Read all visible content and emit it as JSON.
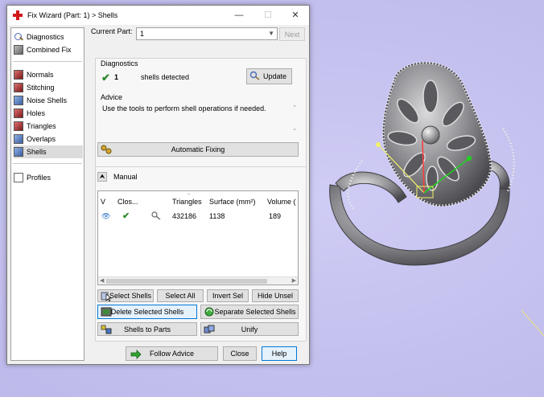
{
  "window": {
    "title": "Fix Wizard (Part: 1) > Shells"
  },
  "nav": {
    "items": [
      {
        "label": "Diagnostics",
        "icon": "wand-icon"
      },
      {
        "label": "Combined Fix",
        "icon": "cube-icon"
      },
      {
        "label": "Normals",
        "icon": "normals-icon"
      },
      {
        "label": "Stitching",
        "icon": "stitching-icon"
      },
      {
        "label": "Noise Shells",
        "icon": "noise-shells-icon"
      },
      {
        "label": "Holes",
        "icon": "holes-icon"
      },
      {
        "label": "Triangles",
        "icon": "triangles-icon"
      },
      {
        "label": "Overlaps",
        "icon": "overlaps-icon"
      },
      {
        "label": "Shells",
        "icon": "shells-icon"
      },
      {
        "label": "Profiles",
        "icon": "profiles-icon"
      }
    ],
    "selected": "Shells"
  },
  "current_part": {
    "label": "Current Part:",
    "value": "1",
    "next_label": "Next"
  },
  "diagnostics": {
    "heading": "Diagnostics",
    "count": "1",
    "text": "shells detected",
    "update_label": "Update"
  },
  "advice": {
    "heading": "Advice",
    "text": "Use the tools to perform shell operations if needed."
  },
  "automatic_fixing_label": "Automatic Fixing",
  "manual": {
    "label": "Manual",
    "columns": [
      "V",
      "Clos...",
      "Triangles",
      "Surface (mm²)",
      "Volume ("
    ],
    "rows": [
      {
        "visible": "eye-icon",
        "closed": "check-icon",
        "tool": "wand-icon",
        "triangles": "432186",
        "surface": "1138",
        "volume": "189"
      }
    ]
  },
  "buttons": {
    "select_shells": "Select Shells",
    "select_all": "Select All",
    "invert_sel": "Invert Sel",
    "hide_unsel": "Hide Unsel",
    "delete_selected_shells": "Delete Selected Shells",
    "separate_selected_shells": "Separate Selected Shells",
    "shells_to_parts": "Shells to Parts",
    "unify": "Unify",
    "follow_advice": "Follow Advice",
    "close": "Close",
    "help": "Help"
  },
  "colors": {
    "viewport_bg": "#c6c3ee",
    "ring_metal": "#7d7d80",
    "gizmo_x": "#ff3b3b",
    "gizmo_y": "#1fd31f",
    "gizmo_z": "#f4f06a"
  }
}
